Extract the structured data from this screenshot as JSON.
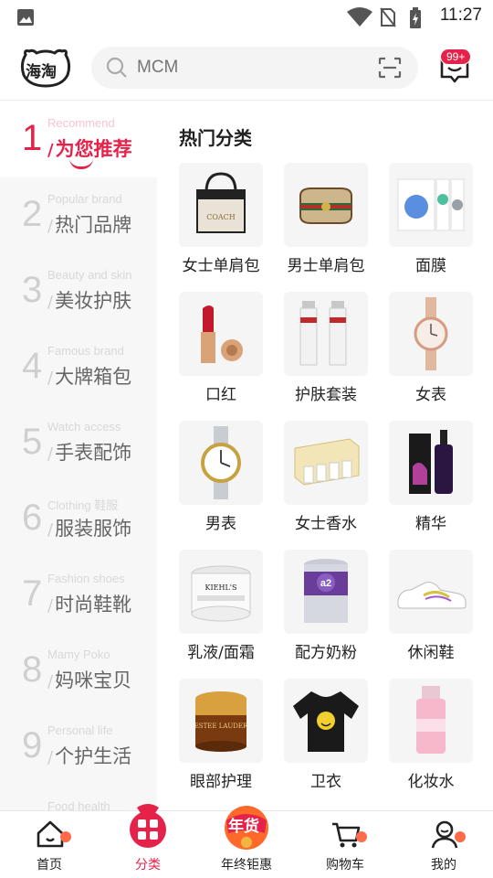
{
  "status_bar": {
    "time": "11:27",
    "icons": [
      "image-icon",
      "wifi-icon",
      "no-sim-icon",
      "battery-charging-icon"
    ]
  },
  "header": {
    "logo_text": "海淘",
    "search": {
      "placeholder": "MCM",
      "value": ""
    },
    "message_badge": "99+"
  },
  "sidebar": {
    "items": [
      {
        "num": "1",
        "en": "Recommend",
        "zh": "为您推荐",
        "active": true
      },
      {
        "num": "2",
        "en": "Popular brand",
        "zh": "热门品牌"
      },
      {
        "num": "3",
        "en": "Beauty and skin",
        "zh": "美妆护肤"
      },
      {
        "num": "4",
        "en": "Famous brand",
        "zh": "大牌箱包"
      },
      {
        "num": "5",
        "en": "Watch access",
        "zh": "手表配饰"
      },
      {
        "num": "6",
        "en": "Clothing 鞋服",
        "zh": "服装服饰"
      },
      {
        "num": "7",
        "en": "Fashion shoes",
        "zh": "时尚鞋靴"
      },
      {
        "num": "8",
        "en": "Mamy Poko",
        "zh": "妈咪宝贝"
      },
      {
        "num": "9",
        "en": "Personal life",
        "zh": "个护生活"
      }
    ],
    "partial_item_en": "Food health"
  },
  "content": {
    "section_title": "热门分类",
    "categories": [
      {
        "label": "女士单肩包",
        "icon": "tote-bag-icon"
      },
      {
        "label": "男士单肩包",
        "icon": "belt-bag-icon"
      },
      {
        "label": "面膜",
        "icon": "face-mask-icon"
      },
      {
        "label": "口红",
        "icon": "lipstick-icon"
      },
      {
        "label": "护肤套装",
        "icon": "skincare-set-icon"
      },
      {
        "label": "女表",
        "icon": "womens-watch-icon"
      },
      {
        "label": "男表",
        "icon": "mens-watch-icon"
      },
      {
        "label": "女士香水",
        "icon": "perfume-icon"
      },
      {
        "label": "精华",
        "icon": "serum-icon"
      },
      {
        "label": "乳液/面霜",
        "icon": "cream-jar-icon"
      },
      {
        "label": "配方奶粉",
        "icon": "milk-powder-icon"
      },
      {
        "label": "休闲鞋",
        "icon": "sneaker-icon"
      },
      {
        "label": "眼部护理",
        "icon": "eye-cream-icon"
      },
      {
        "label": "卫衣",
        "icon": "sweatshirt-icon"
      },
      {
        "label": "化妆水",
        "icon": "toner-icon"
      }
    ]
  },
  "bottom_nav": {
    "items": [
      {
        "label": "首页",
        "icon": "home-icon"
      },
      {
        "label": "分类",
        "icon": "category-icon",
        "active": true
      },
      {
        "label": "年终钜惠",
        "icon": "new-year-sale-icon",
        "badge_text": "年货"
      },
      {
        "label": "购物车",
        "icon": "cart-icon"
      },
      {
        "label": "我的",
        "icon": "profile-icon"
      }
    ]
  },
  "colors": {
    "accent": "#e5224a",
    "sidebar_bg": "#f7f7f7"
  }
}
